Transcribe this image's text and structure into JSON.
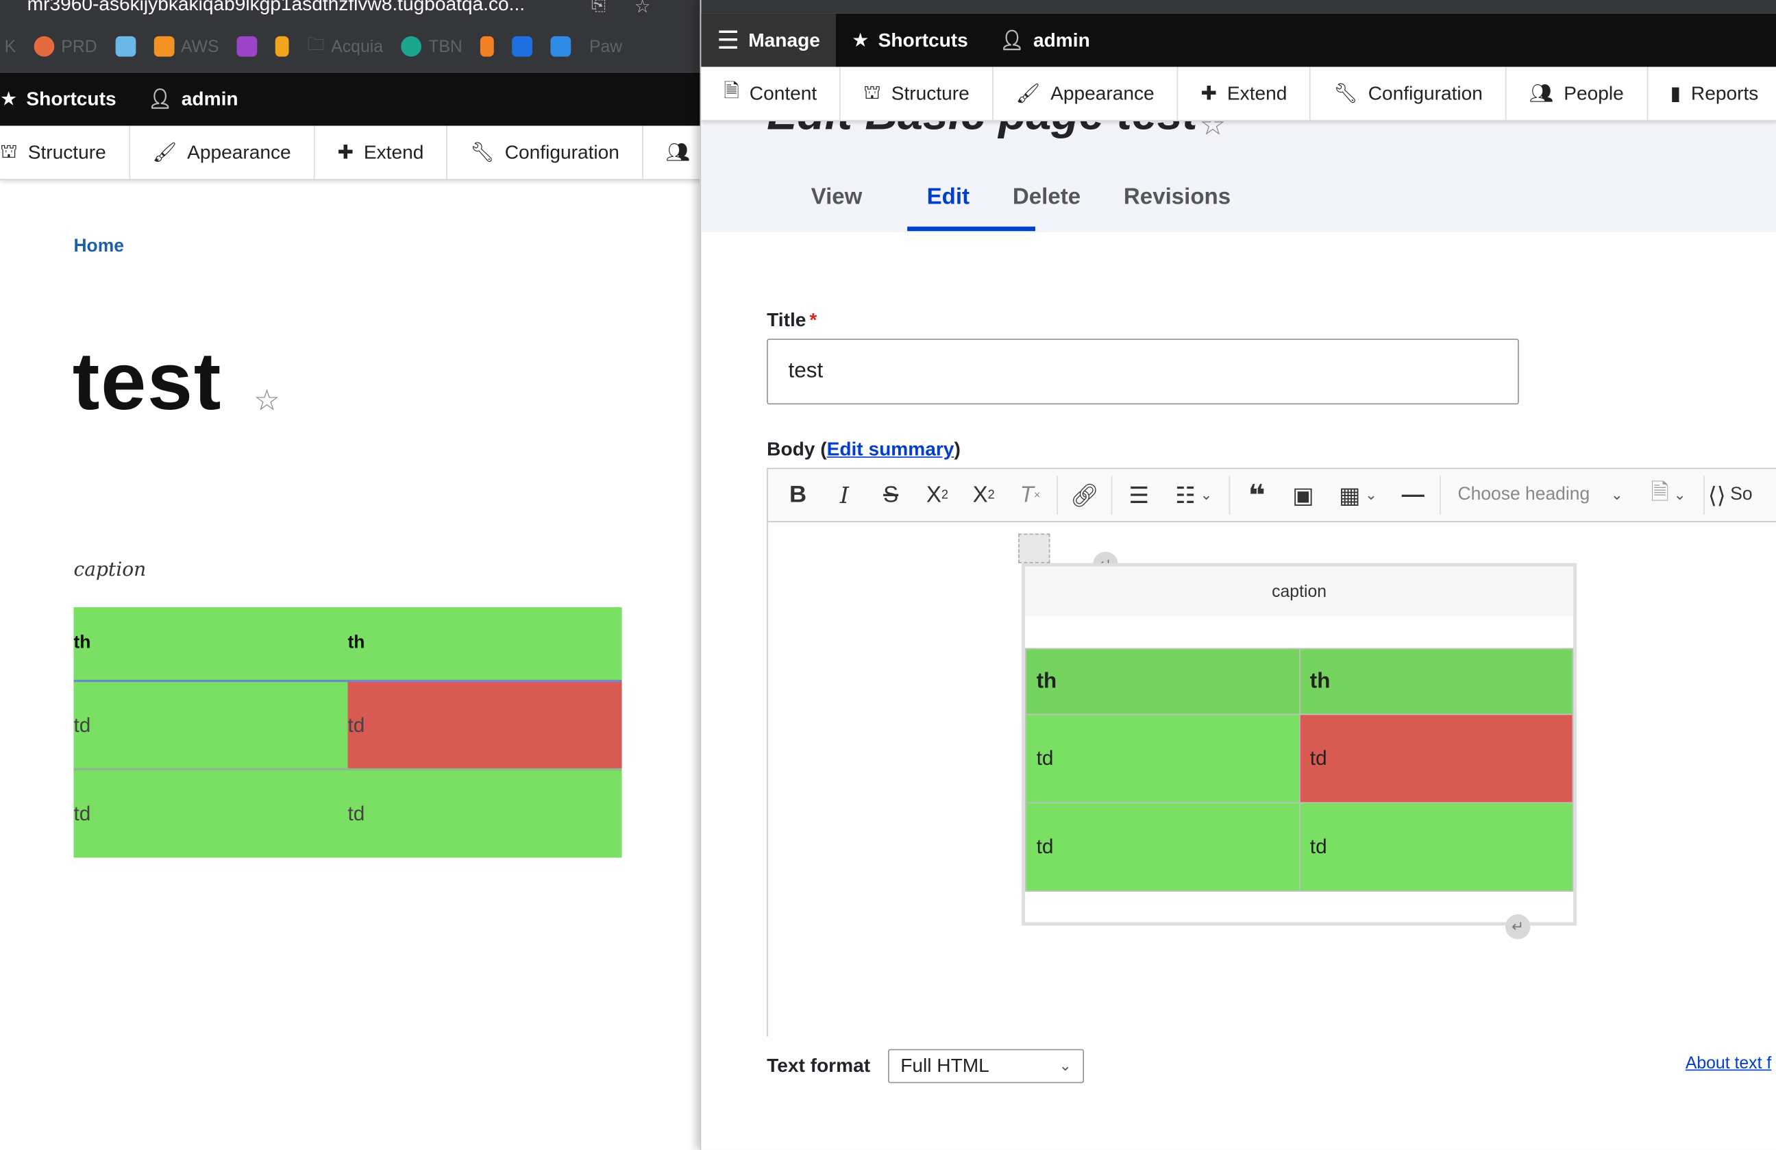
{
  "left_window": {
    "url": "mr3960-as6kijybkakiqab9lkgp1asdthzflvw8.tugboatqa.co...",
    "bookmarks": [
      "K",
      "PRD",
      "",
      "AWS",
      "",
      "",
      "Acquia",
      "TBN",
      "",
      "",
      "",
      "Paw"
    ],
    "toolbar": {
      "shortcuts": "Shortcuts",
      "user": "admin"
    },
    "tray": [
      "Structure",
      "Appearance",
      "Extend",
      "Configuration",
      "Pe"
    ],
    "breadcrumb": "Home",
    "page_title": "test",
    "table": {
      "caption": "caption",
      "headers": [
        "th",
        "th"
      ],
      "rows": [
        [
          "td",
          "td"
        ],
        [
          "td",
          "td"
        ]
      ]
    }
  },
  "right_window": {
    "toolbar": {
      "manage": "Manage",
      "shortcuts": "Shortcuts",
      "user": "admin"
    },
    "tray": [
      "Content",
      "Structure",
      "Appearance",
      "Extend",
      "Configuration",
      "People",
      "Reports"
    ],
    "page_title": "Edit Basic page test",
    "tabs": [
      {
        "label": "View",
        "active": false
      },
      {
        "label": "Edit",
        "active": true
      },
      {
        "label": "Delete",
        "active": false
      },
      {
        "label": "Revisions",
        "active": false
      }
    ],
    "form": {
      "title_label": "Title",
      "required_mark": "*",
      "title_value": "test",
      "body_label_prefix": "Body (",
      "edit_summary": "Edit summary",
      "body_label_suffix": ")",
      "heading_placeholder": "Choose heading",
      "source_label": "So",
      "text_format_label": "Text format",
      "text_format_value": "Full HTML",
      "about_link": "About text f"
    },
    "editor_table": {
      "caption": "caption",
      "headers": [
        "th",
        "th"
      ],
      "rows": [
        [
          "td",
          "td"
        ],
        [
          "td",
          "td"
        ]
      ]
    }
  },
  "colors": {
    "cell_green": "#7ae063",
    "header_green": "#74d45f",
    "cell_red": "#d85a53",
    "accent": "#003ecc"
  }
}
